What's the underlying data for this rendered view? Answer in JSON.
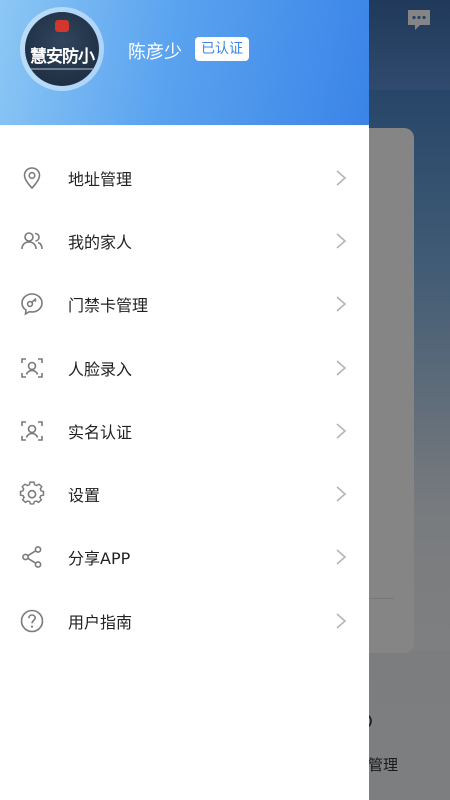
{
  "user": {
    "avatar_text": "慧安防小",
    "name": "陈彦少",
    "verified_badge": "已认证"
  },
  "menu": {
    "items": [
      {
        "label": "地址管理",
        "icon": "location-pin-icon"
      },
      {
        "label": "我的家人",
        "icon": "family-icon"
      },
      {
        "label": "门禁卡管理",
        "icon": "access-card-icon"
      },
      {
        "label": "人脸录入",
        "icon": "face-scan-icon"
      },
      {
        "label": "实名认证",
        "icon": "id-verify-icon"
      },
      {
        "label": "设置",
        "icon": "gear-icon"
      },
      {
        "label": "分享APP",
        "icon": "share-icon"
      },
      {
        "label": "用户指南",
        "icon": "help-icon"
      }
    ]
  },
  "background": {
    "bottom_tab_label": "管理"
  },
  "colors": {
    "header_gradient_start": "#8cc7f5",
    "header_gradient_end": "#3b84e8",
    "badge_text": "#3d86e8",
    "icon_stroke": "#7a7a7a",
    "chevron": "#b5b5b5"
  }
}
